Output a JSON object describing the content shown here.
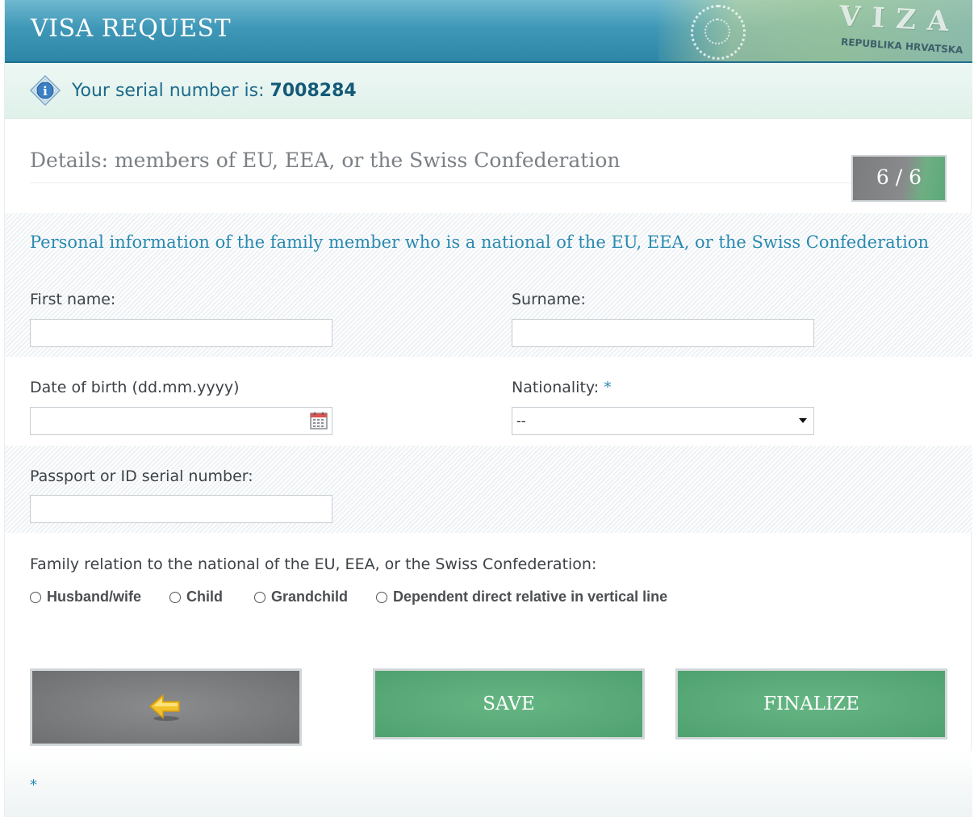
{
  "header": {
    "title": "VISA REQUEST",
    "stamp_word": "VIZA",
    "stamp_country": "REPUBLIKA HRVATSKA"
  },
  "serial": {
    "prefix": "Your serial number is: ",
    "number": "7008284"
  },
  "section": {
    "title": "Details: members of EU, EEA, or the Swiss Confederation",
    "step": "6 / 6"
  },
  "form": {
    "subheading": "Personal information of the family member who is a national of the EU, EEA, or the Swiss Confederation",
    "first_name_label": "First name:",
    "first_name_value": "",
    "surname_label": "Surname:",
    "surname_value": "",
    "dob_label": "Date of birth (dd.mm.yyyy)",
    "dob_value": "",
    "nationality_label": "Nationality:",
    "nationality_required": "*",
    "nationality_value": "--",
    "passport_label": "Passport or ID serial number:",
    "passport_value": "",
    "relation_label": "Family relation to the national of the EU, EEA, or the Swiss Confederation:",
    "relation_options": [
      "Husband/wife",
      "Child",
      "Grandchild",
      "Dependent direct relative in vertical line"
    ]
  },
  "buttons": {
    "save": "SAVE",
    "finalize": "FINALIZE"
  },
  "footnote": "*",
  "icons": {
    "info": "info-icon",
    "calendar": "calendar-icon",
    "back": "back-arrow-icon"
  },
  "colors": {
    "accent": "#2a8ab0",
    "header": "#3f98b7",
    "button_green": "#5aab79",
    "button_gray": "#7a7c7e"
  }
}
